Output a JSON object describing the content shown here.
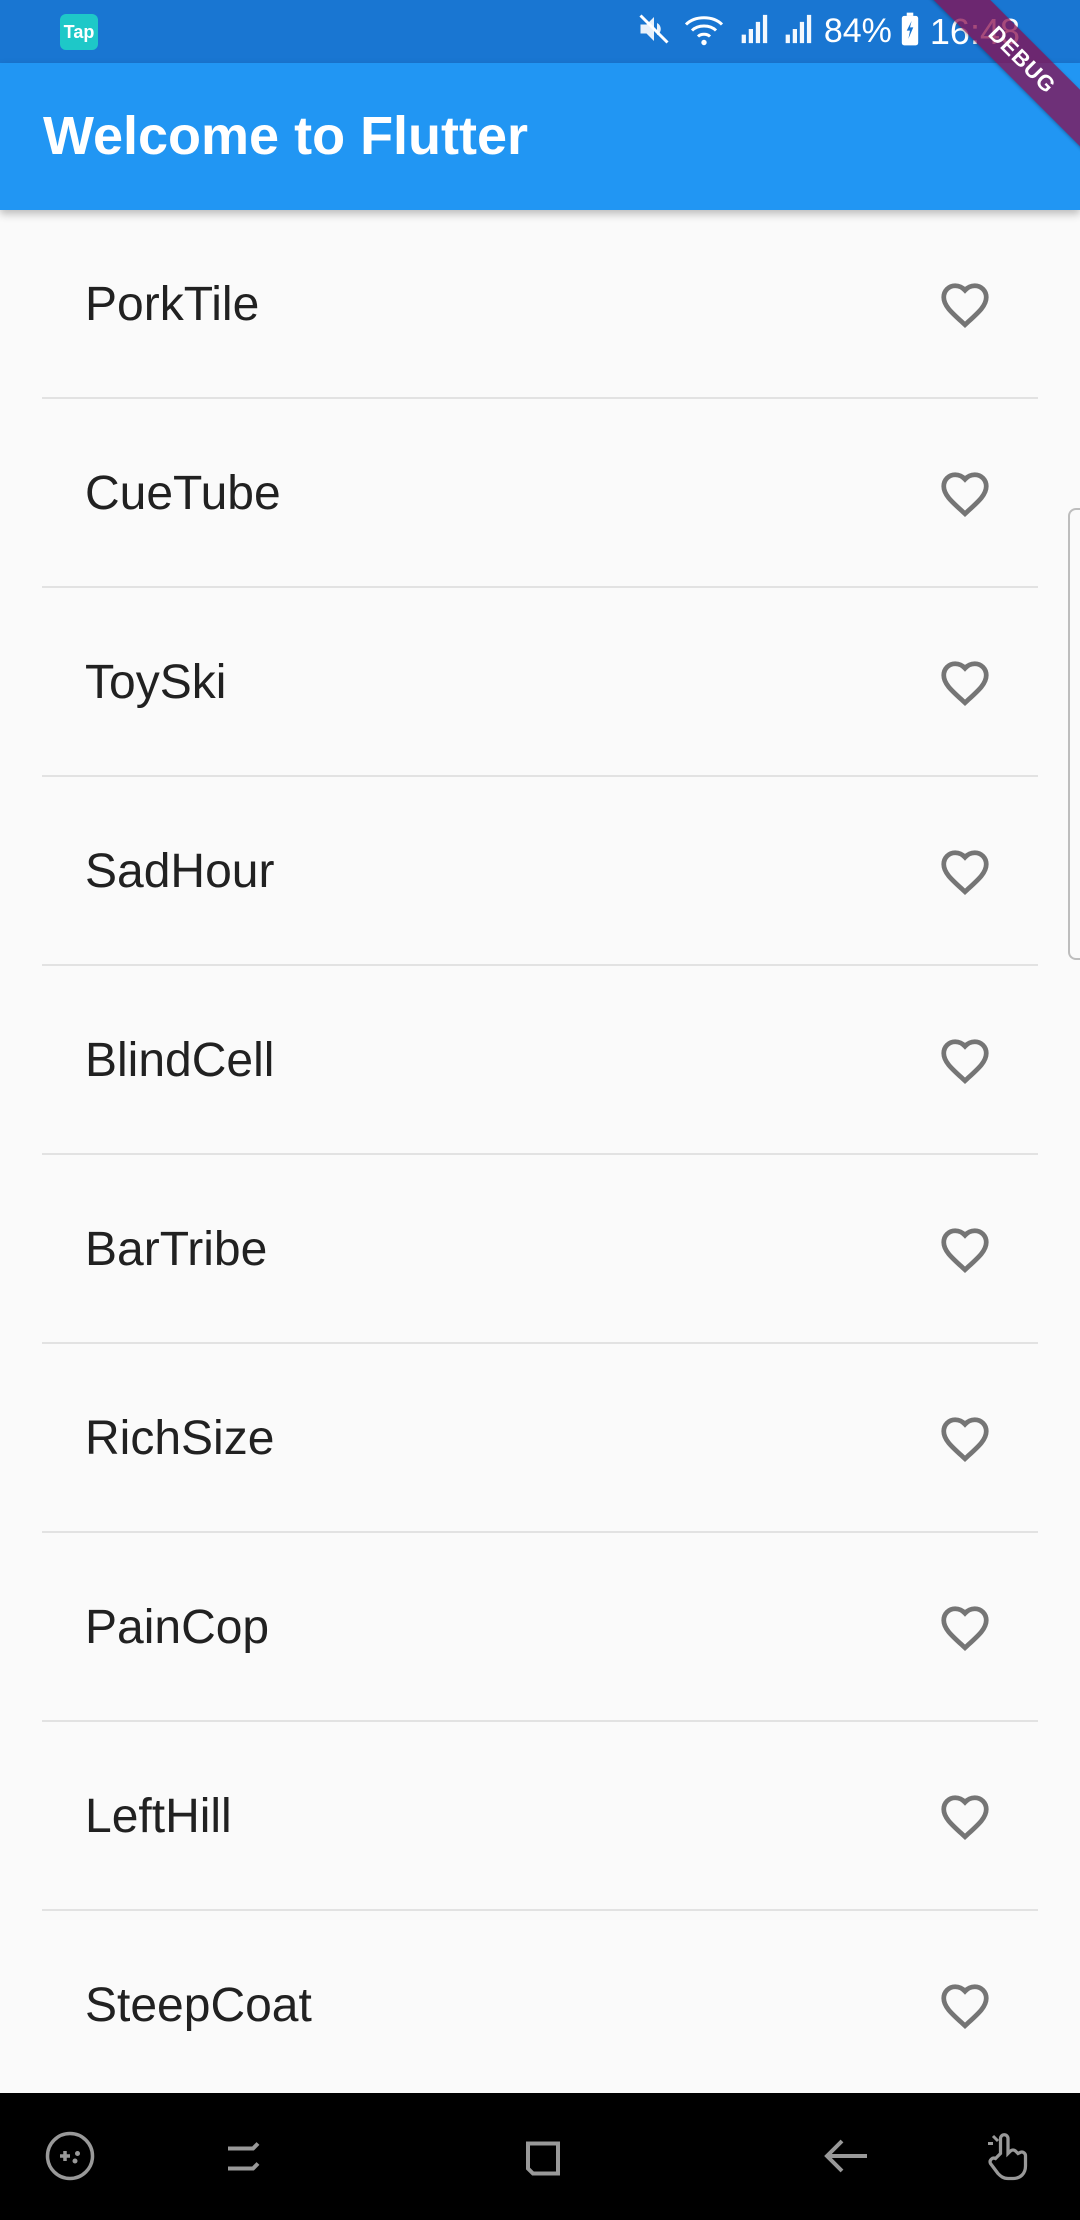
{
  "status_bar": {
    "app_icon_label": "Tap",
    "battery": "84%",
    "time": "16:48"
  },
  "debug_banner": "DEBUG",
  "app_bar": {
    "title": "Welcome to Flutter"
  },
  "list": {
    "items": [
      {
        "label": "PorkTile"
      },
      {
        "label": "CueTube"
      },
      {
        "label": "ToySki"
      },
      {
        "label": "SadHour"
      },
      {
        "label": "BlindCell"
      },
      {
        "label": "BarTribe"
      },
      {
        "label": "RichSize"
      },
      {
        "label": "PainCop"
      },
      {
        "label": "LeftHill"
      },
      {
        "label": "SteepCoat"
      }
    ],
    "item_icon": "heart-outline-icon"
  },
  "colors": {
    "status_bar": "#1976d2",
    "app_bar": "#2196f3",
    "background": "#fafafa",
    "heart": "#757575",
    "divider": "#e2e2e2"
  },
  "nav_bar": {
    "icons": [
      "game-launcher-icon",
      "recent-apps-icon",
      "home-icon",
      "back-icon",
      "touch-gesture-icon"
    ]
  }
}
